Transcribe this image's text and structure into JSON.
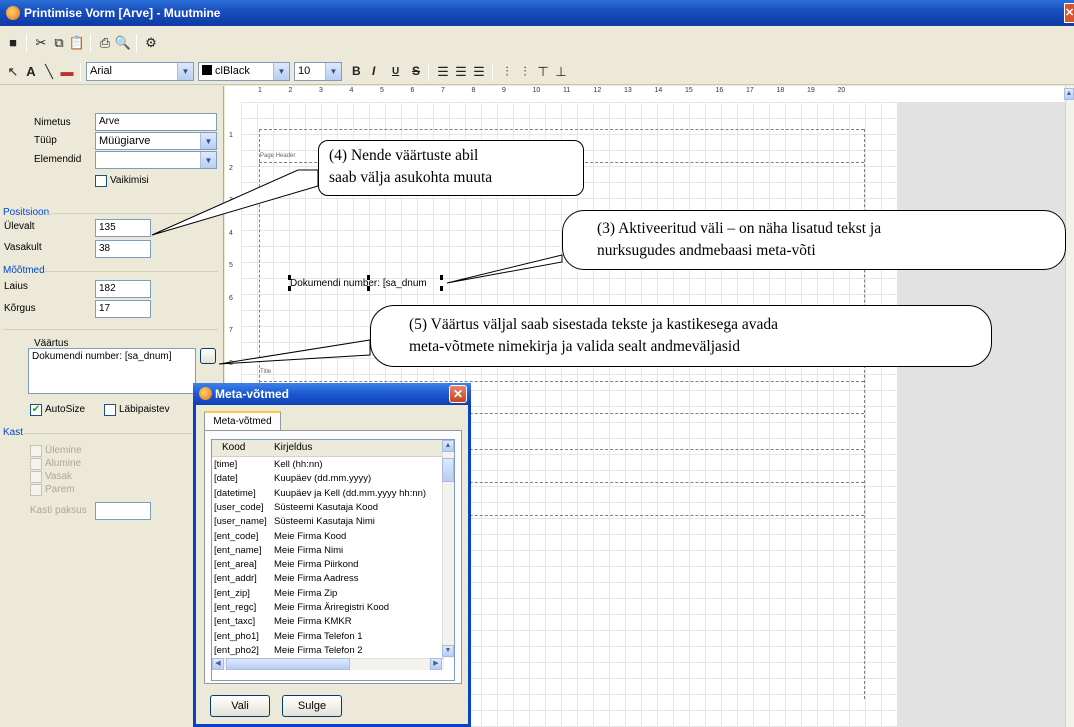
{
  "window": {
    "title": "Printimise Vorm [Arve] - Muutmine",
    "close": "X"
  },
  "toolbar": {
    "font": "Arial",
    "color": "clBlack",
    "size": "10",
    "bold": "B",
    "italic": "I",
    "underline": "U",
    "strike": "S",
    "text_tool": "A"
  },
  "props": {
    "nimetus_label": "Nimetus",
    "nimetus_value": "Arve",
    "tyyp_label": "Tüüp",
    "tyyp_value": "Müügiarve",
    "elemendid_label": "Elemendid",
    "elemendid_value": "",
    "vaikimisi": "Vaikimisi",
    "positsioon": "Positsioon",
    "ulevalt_label": "Ülevalt",
    "ulevalt_value": "135",
    "vasakult_label": "Vasakult",
    "vasakult_value": "38",
    "mootmed": "Mõõtmed",
    "laius_label": "Laius",
    "laius_value": "182",
    "korgus_label": "Kõrgus",
    "korgus_value": "17",
    "vaartus": "Väärtus",
    "vaartus_value": "Dokumendi number: [sa_dnum]",
    "autosize": "AutoSize",
    "autosize_checked": true,
    "labipaistev": "Läbipaistev",
    "kast": "Kast",
    "ulemine": "Ülemine",
    "alumine": "Alumine",
    "vasak": "Vasak",
    "parem": "Parem",
    "kasti_paksus": "Kasti paksus"
  },
  "ruler": [
    "1",
    "2",
    "3",
    "4",
    "5",
    "6",
    "7",
    "8",
    "9",
    "10",
    "11",
    "12",
    "13",
    "14",
    "15",
    "16",
    "17",
    "18",
    "19",
    "20"
  ],
  "ruler_left": [
    "1",
    "2",
    "3",
    "4",
    "5",
    "6",
    "7",
    "8"
  ],
  "canvas": {
    "page_header": "Page Header",
    "title_band": "Title",
    "selected_text": "Dokumendi number: [sa_dnum"
  },
  "callouts": {
    "c4_line1": "(4) Nende väärtuste abil",
    "c4_line2": "saab välja asukohta muuta",
    "c3_line1": "(3) Aktiveeritud väli – on näha lisatud tekst ja",
    "c3_line2": "nurksugudes andmebaasi meta-võti",
    "c5_line1": "(5) Väärtus väljal saab sisestada tekste ja kastikesega avada",
    "c5_line2": "meta-võtmete nimekirja ja valida sealt andmeväljasid"
  },
  "dialog": {
    "title": "Meta-võtmed",
    "tab": "Meta-võtmed",
    "col_kood": "Kood",
    "col_kirjeldus": "Kirjeldus",
    "rows": [
      {
        "kood": "[time]",
        "kirjeldus": "Kell (hh:nn)"
      },
      {
        "kood": "[date]",
        "kirjeldus": "Kuupäev (dd.mm.yyyy)"
      },
      {
        "kood": "[datetime]",
        "kirjeldus": "Kuupäev ja Kell (dd.mm.yyyy hh:nn)"
      },
      {
        "kood": "[user_code]",
        "kirjeldus": "Süsteemi Kasutaja Kood"
      },
      {
        "kood": "[user_name]",
        "kirjeldus": "Süsteemi Kasutaja Nimi"
      },
      {
        "kood": "[ent_code]",
        "kirjeldus": "Meie Firma Kood"
      },
      {
        "kood": "[ent_name]",
        "kirjeldus": "Meie Firma Nimi"
      },
      {
        "kood": "[ent_area]",
        "kirjeldus": "Meie Firma Piirkond"
      },
      {
        "kood": "[ent_addr]",
        "kirjeldus": "Meie Firma Aadress"
      },
      {
        "kood": "[ent_zip]",
        "kirjeldus": "Meie Firma Zip"
      },
      {
        "kood": "[ent_regc]",
        "kirjeldus": "Meie Firma Äriregistri Kood"
      },
      {
        "kood": "[ent_taxc]",
        "kirjeldus": "Meie Firma KMKR"
      },
      {
        "kood": "[ent_pho1]",
        "kirjeldus": "Meie Firma Telefon 1"
      },
      {
        "kood": "[ent_pho2]",
        "kirjeldus": "Meie Firma Telefon 2"
      }
    ],
    "vali": "Vali",
    "sulge": "Sulge"
  }
}
